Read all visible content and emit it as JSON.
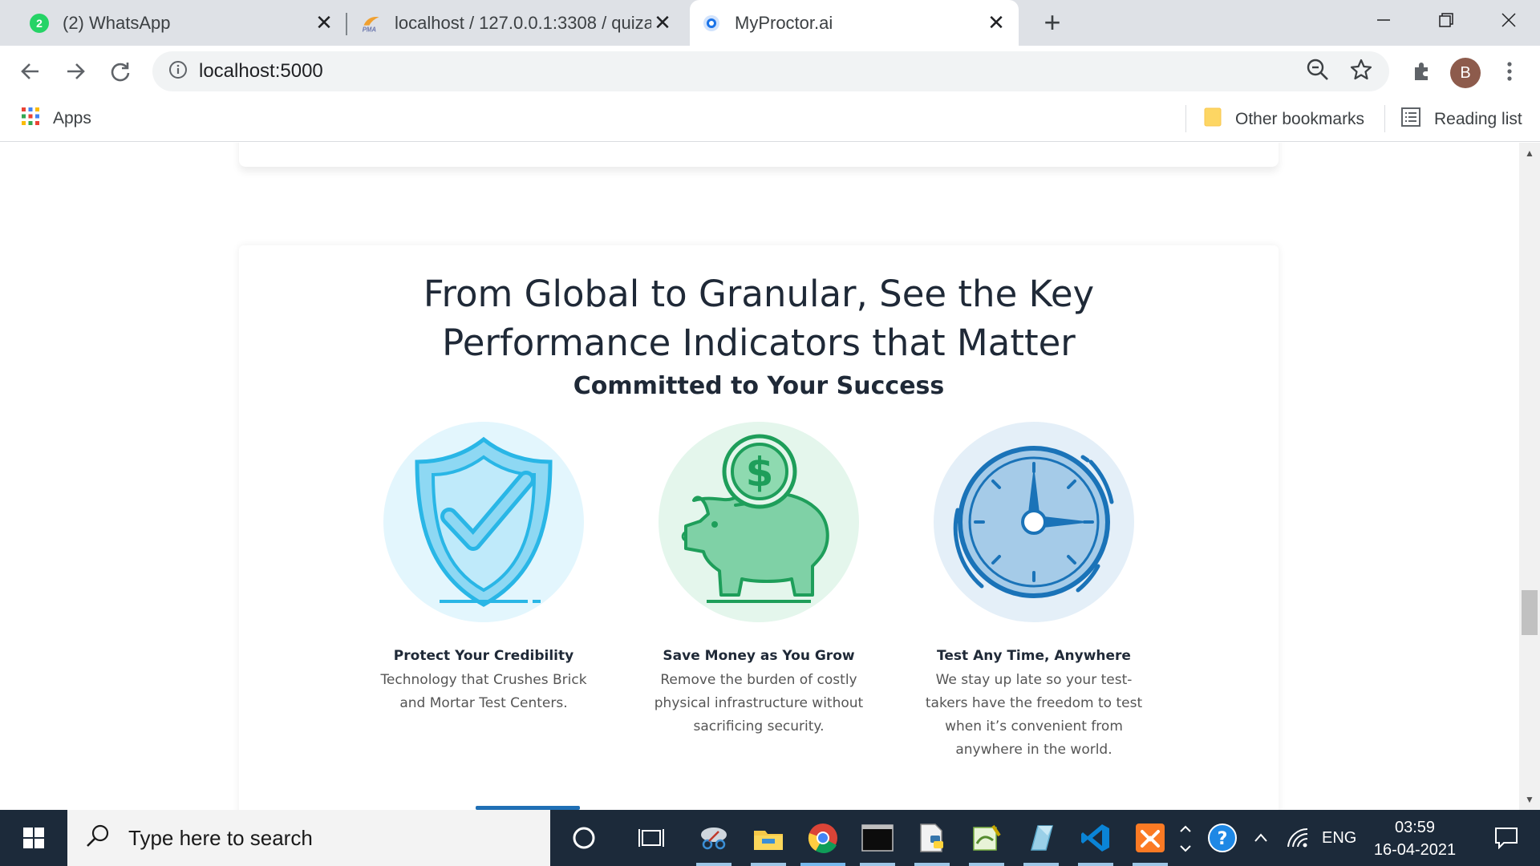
{
  "browser": {
    "tabs": [
      {
        "title": "(2) WhatsApp",
        "badge": "2",
        "active": false
      },
      {
        "title": "localhost / 127.0.0.1:3308 / quiza",
        "favicon_text": "PMA",
        "active": false
      },
      {
        "title": "MyProctor.ai",
        "active": true
      }
    ],
    "url": "localhost:5000",
    "profile_initial": "B",
    "bookmarks": {
      "apps_label": "Apps",
      "other_label": "Other bookmarks",
      "reading_label": "Reading list"
    }
  },
  "page": {
    "headline_line1": "From Global to Granular, See the Key",
    "headline_line2": "Performance Indicators that Matter",
    "subheading": "Committed to Your Success",
    "features": [
      {
        "icon": "shield-check-icon",
        "title": "Protect Your Credibility",
        "desc_lines": [
          "Technology that Crushes Brick",
          "and Mortar Test Centers."
        ]
      },
      {
        "icon": "piggy-bank-icon",
        "title": "Save Money as You Grow",
        "desc_lines": [
          "Remove the burden of costly",
          "physical infrastructure without",
          "sacrificing security."
        ]
      },
      {
        "icon": "clock-icon",
        "title": "Test Any Time, Anywhere",
        "desc_lines": [
          "We stay up late so your test-",
          "takers have the freedom to test",
          "when it’s convenient from",
          "anywhere in the world."
        ]
      }
    ]
  },
  "taskbar": {
    "search_placeholder": "Type here to search",
    "language": "ENG",
    "time": "03:59",
    "date": "16-04-2021"
  },
  "colors": {
    "shield_blue": "#29b6e6",
    "piggy_green": "#4cc38a",
    "clock_blue": "#1a73b8",
    "taskbar": "#1c2a3a"
  }
}
